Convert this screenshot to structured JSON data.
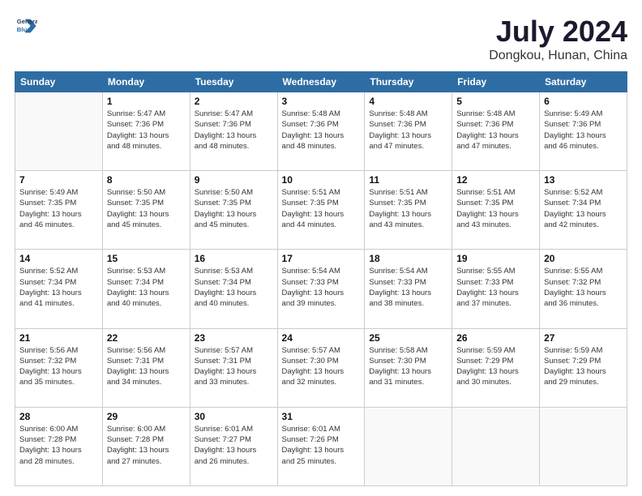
{
  "header": {
    "logo_line1": "General",
    "logo_line2": "Blue",
    "title": "July 2024",
    "subtitle": "Dongkou, Hunan, China"
  },
  "weekdays": [
    "Sunday",
    "Monday",
    "Tuesday",
    "Wednesday",
    "Thursday",
    "Friday",
    "Saturday"
  ],
  "weeks": [
    [
      {
        "day": "",
        "info": ""
      },
      {
        "day": "1",
        "info": "Sunrise: 5:47 AM\nSunset: 7:36 PM\nDaylight: 13 hours\nand 48 minutes."
      },
      {
        "day": "2",
        "info": "Sunrise: 5:47 AM\nSunset: 7:36 PM\nDaylight: 13 hours\nand 48 minutes."
      },
      {
        "day": "3",
        "info": "Sunrise: 5:48 AM\nSunset: 7:36 PM\nDaylight: 13 hours\nand 48 minutes."
      },
      {
        "day": "4",
        "info": "Sunrise: 5:48 AM\nSunset: 7:36 PM\nDaylight: 13 hours\nand 47 minutes."
      },
      {
        "day": "5",
        "info": "Sunrise: 5:48 AM\nSunset: 7:36 PM\nDaylight: 13 hours\nand 47 minutes."
      },
      {
        "day": "6",
        "info": "Sunrise: 5:49 AM\nSunset: 7:36 PM\nDaylight: 13 hours\nand 46 minutes."
      }
    ],
    [
      {
        "day": "7",
        "info": "Sunrise: 5:49 AM\nSunset: 7:35 PM\nDaylight: 13 hours\nand 46 minutes."
      },
      {
        "day": "8",
        "info": "Sunrise: 5:50 AM\nSunset: 7:35 PM\nDaylight: 13 hours\nand 45 minutes."
      },
      {
        "day": "9",
        "info": "Sunrise: 5:50 AM\nSunset: 7:35 PM\nDaylight: 13 hours\nand 45 minutes."
      },
      {
        "day": "10",
        "info": "Sunrise: 5:51 AM\nSunset: 7:35 PM\nDaylight: 13 hours\nand 44 minutes."
      },
      {
        "day": "11",
        "info": "Sunrise: 5:51 AM\nSunset: 7:35 PM\nDaylight: 13 hours\nand 43 minutes."
      },
      {
        "day": "12",
        "info": "Sunrise: 5:51 AM\nSunset: 7:35 PM\nDaylight: 13 hours\nand 43 minutes."
      },
      {
        "day": "13",
        "info": "Sunrise: 5:52 AM\nSunset: 7:34 PM\nDaylight: 13 hours\nand 42 minutes."
      }
    ],
    [
      {
        "day": "14",
        "info": "Sunrise: 5:52 AM\nSunset: 7:34 PM\nDaylight: 13 hours\nand 41 minutes."
      },
      {
        "day": "15",
        "info": "Sunrise: 5:53 AM\nSunset: 7:34 PM\nDaylight: 13 hours\nand 40 minutes."
      },
      {
        "day": "16",
        "info": "Sunrise: 5:53 AM\nSunset: 7:34 PM\nDaylight: 13 hours\nand 40 minutes."
      },
      {
        "day": "17",
        "info": "Sunrise: 5:54 AM\nSunset: 7:33 PM\nDaylight: 13 hours\nand 39 minutes."
      },
      {
        "day": "18",
        "info": "Sunrise: 5:54 AM\nSunset: 7:33 PM\nDaylight: 13 hours\nand 38 minutes."
      },
      {
        "day": "19",
        "info": "Sunrise: 5:55 AM\nSunset: 7:33 PM\nDaylight: 13 hours\nand 37 minutes."
      },
      {
        "day": "20",
        "info": "Sunrise: 5:55 AM\nSunset: 7:32 PM\nDaylight: 13 hours\nand 36 minutes."
      }
    ],
    [
      {
        "day": "21",
        "info": "Sunrise: 5:56 AM\nSunset: 7:32 PM\nDaylight: 13 hours\nand 35 minutes."
      },
      {
        "day": "22",
        "info": "Sunrise: 5:56 AM\nSunset: 7:31 PM\nDaylight: 13 hours\nand 34 minutes."
      },
      {
        "day": "23",
        "info": "Sunrise: 5:57 AM\nSunset: 7:31 PM\nDaylight: 13 hours\nand 33 minutes."
      },
      {
        "day": "24",
        "info": "Sunrise: 5:57 AM\nSunset: 7:30 PM\nDaylight: 13 hours\nand 32 minutes."
      },
      {
        "day": "25",
        "info": "Sunrise: 5:58 AM\nSunset: 7:30 PM\nDaylight: 13 hours\nand 31 minutes."
      },
      {
        "day": "26",
        "info": "Sunrise: 5:59 AM\nSunset: 7:29 PM\nDaylight: 13 hours\nand 30 minutes."
      },
      {
        "day": "27",
        "info": "Sunrise: 5:59 AM\nSunset: 7:29 PM\nDaylight: 13 hours\nand 29 minutes."
      }
    ],
    [
      {
        "day": "28",
        "info": "Sunrise: 6:00 AM\nSunset: 7:28 PM\nDaylight: 13 hours\nand 28 minutes."
      },
      {
        "day": "29",
        "info": "Sunrise: 6:00 AM\nSunset: 7:28 PM\nDaylight: 13 hours\nand 27 minutes."
      },
      {
        "day": "30",
        "info": "Sunrise: 6:01 AM\nSunset: 7:27 PM\nDaylight: 13 hours\nand 26 minutes."
      },
      {
        "day": "31",
        "info": "Sunrise: 6:01 AM\nSunset: 7:26 PM\nDaylight: 13 hours\nand 25 minutes."
      },
      {
        "day": "",
        "info": ""
      },
      {
        "day": "",
        "info": ""
      },
      {
        "day": "",
        "info": ""
      }
    ]
  ]
}
